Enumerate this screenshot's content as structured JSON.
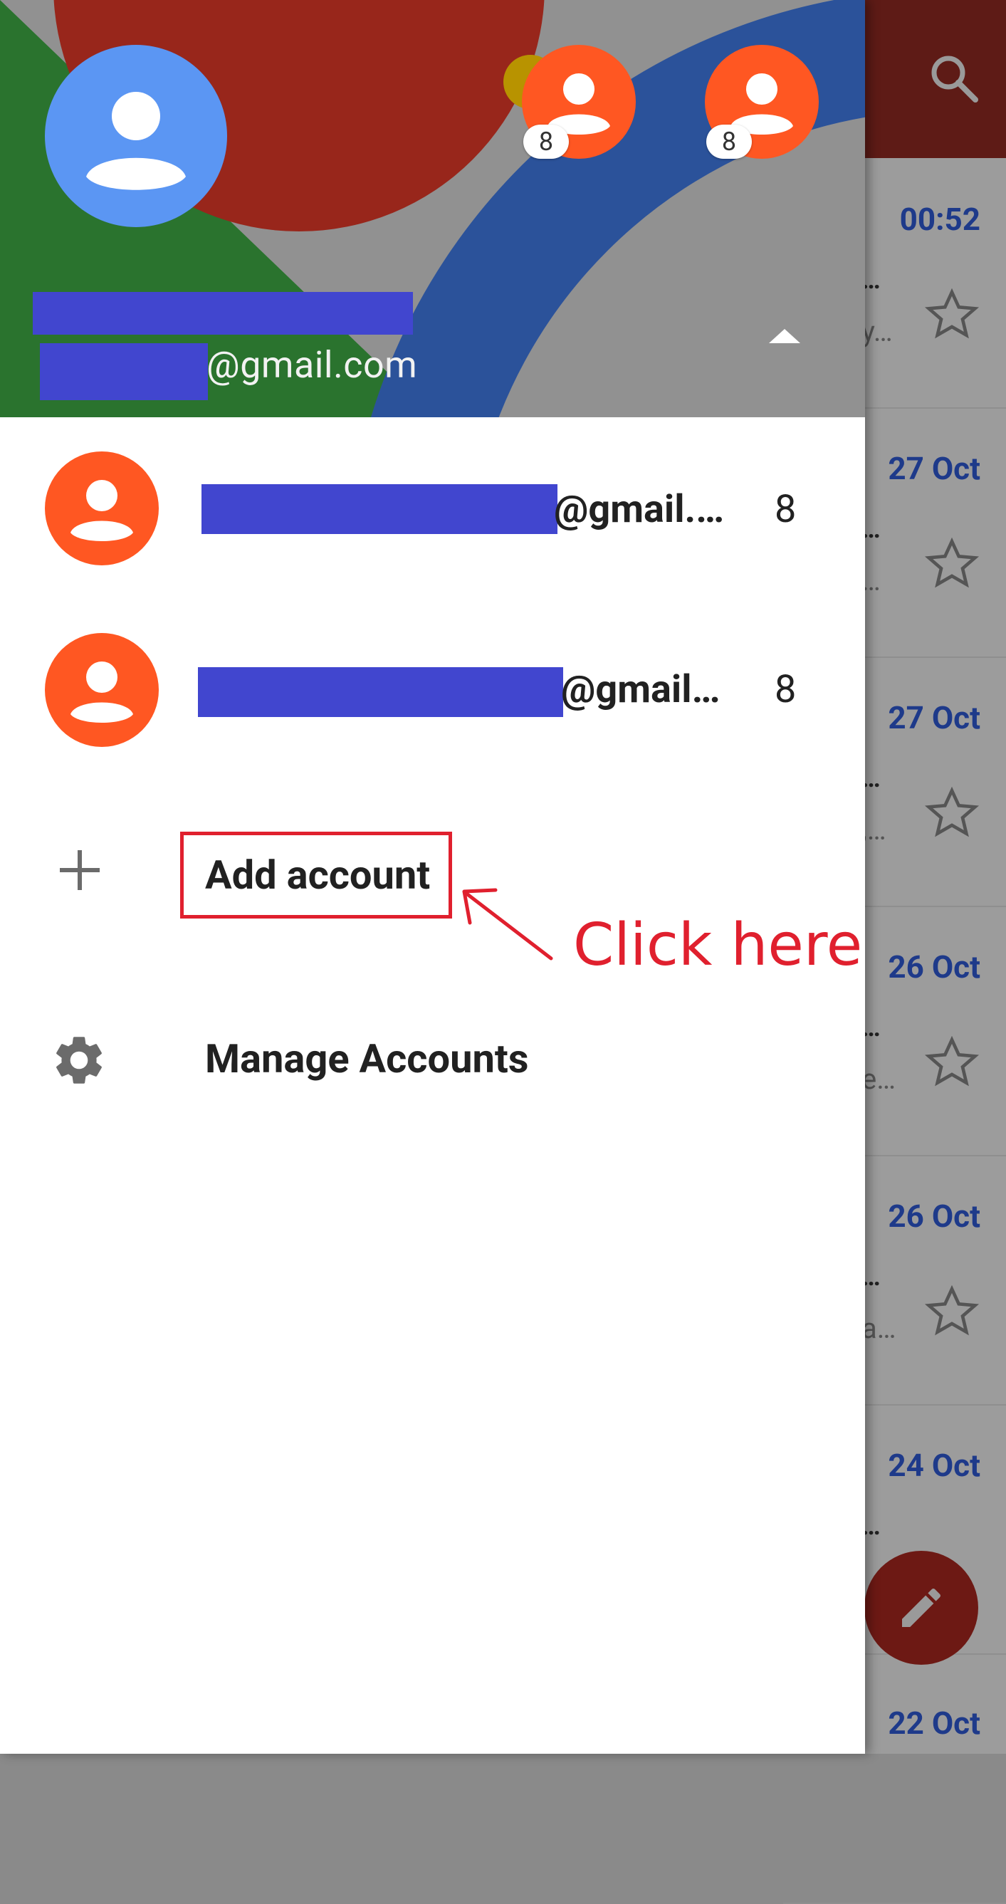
{
  "background_list": {
    "dates": [
      "00:52",
      "27 Oct",
      "27 Oct",
      "26 Oct",
      "26 Oct",
      "24 Oct",
      "22 Oct"
    ],
    "snippets": [
      "y…",
      "…",
      ",…",
      "e…",
      "a…",
      "",
      ""
    ]
  },
  "drawer": {
    "header": {
      "email_suffix": "@gmail.com",
      "other_accounts": [
        {
          "badge": "8"
        },
        {
          "badge": "8"
        }
      ]
    },
    "accounts": [
      {
        "email_suffix": "@gmail.…",
        "count": "8"
      },
      {
        "email_suffix": "@gmail…",
        "count": "8"
      }
    ],
    "add_account_label": "Add account",
    "manage_accounts_label": "Manage Accounts"
  },
  "annotation": {
    "callout_text": "Click here",
    "color": "#e0202e"
  },
  "colors": {
    "primary_avatar": "#5b96f3",
    "account_avatar": "#ff5722",
    "redaction": "#4146cf"
  }
}
